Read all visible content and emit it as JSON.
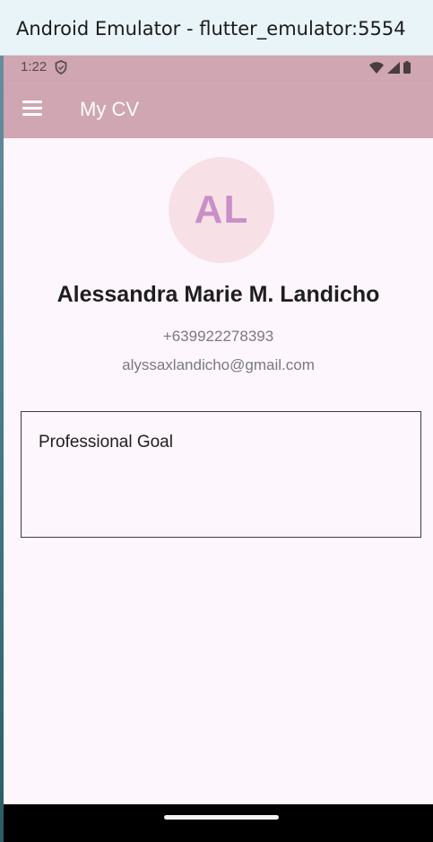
{
  "window": {
    "title": "Android Emulator - flutter_emulator:5554"
  },
  "statusbar": {
    "time": "1:22",
    "icons": [
      "shield-icon",
      "wifi-icon",
      "signal-icon",
      "battery-icon"
    ]
  },
  "appbar": {
    "title": "My CV",
    "menu_icon": "menu-icon"
  },
  "profile": {
    "initials": "AL",
    "name": "Alessandra Marie M. Landicho",
    "phone": "+639922278393",
    "email": "alyssaxlandicho@gmail.com"
  },
  "sections": {
    "goal_title": "Professional Goal"
  },
  "colors": {
    "appbar": "#cfa6b1",
    "background": "#fdf6fc",
    "avatar_bg": "#f7e1e6",
    "avatar_text": "#c98fc7"
  }
}
